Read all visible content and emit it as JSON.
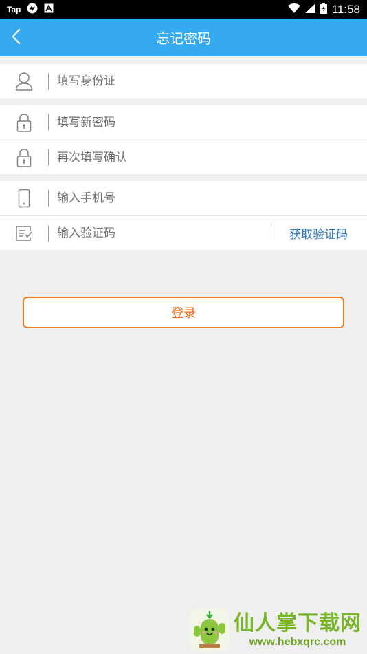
{
  "status_bar": {
    "carrier": "Tap",
    "time": "11:58"
  },
  "nav": {
    "title": "忘记密码"
  },
  "form": {
    "id_card_placeholder": "填写身份证",
    "new_password_placeholder": "填写新密码",
    "confirm_password_placeholder": "再次填写确认",
    "phone_placeholder": "输入手机号",
    "code_placeholder": "输入验证码",
    "get_code_label": "获取验证码"
  },
  "login_button": "登录",
  "watermark": {
    "title": "仙人掌下载网",
    "url": "www.hebxqrc.com"
  },
  "colors": {
    "nav": "#35aaf0",
    "accent": "#f07b22",
    "link": "#2a78c2"
  }
}
